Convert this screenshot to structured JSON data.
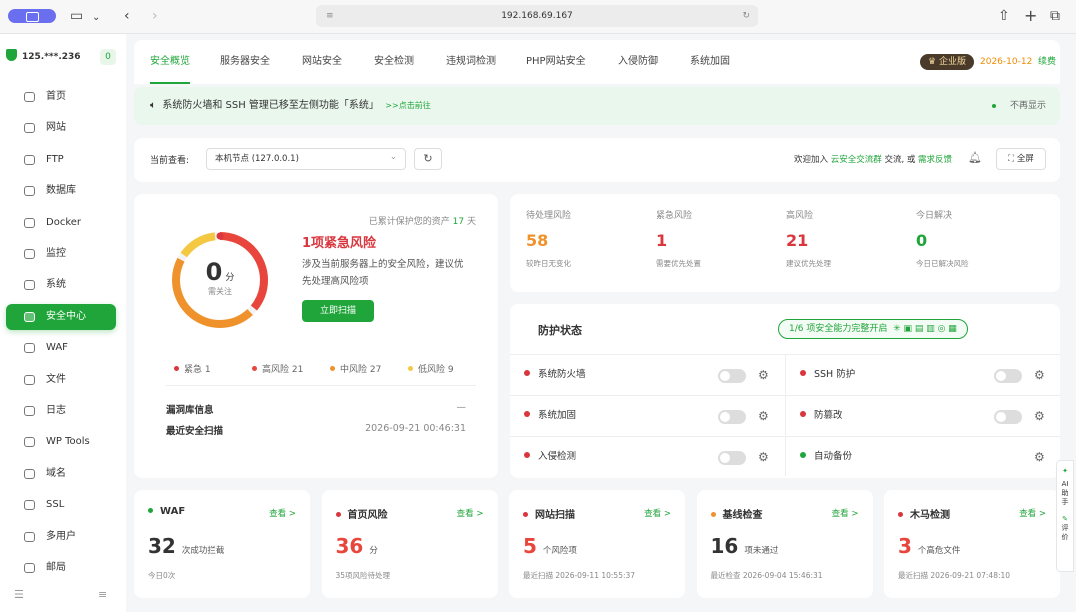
{
  "browser": {
    "address": "192.168.69.167"
  },
  "sidebar": {
    "host": "125.***.236",
    "host_count": "0",
    "items": [
      {
        "label": "首页",
        "icon": "home-icon"
      },
      {
        "label": "网站",
        "icon": "globe-icon"
      },
      {
        "label": "FTP",
        "icon": "transfer-icon"
      },
      {
        "label": "数据库",
        "icon": "database-icon"
      },
      {
        "label": "Docker",
        "icon": "docker-icon"
      },
      {
        "label": "监控",
        "icon": "monitor-icon"
      },
      {
        "label": "系统",
        "icon": "system-icon"
      },
      {
        "label": "安全中心",
        "icon": "shield-icon",
        "active": true
      },
      {
        "label": "WAF",
        "icon": "waf-icon"
      },
      {
        "label": "文件",
        "icon": "folder-icon"
      },
      {
        "label": "日志",
        "icon": "log-icon"
      },
      {
        "label": "WP Tools",
        "icon": "wordpress-icon"
      },
      {
        "label": "域名",
        "icon": "domain-icon"
      },
      {
        "label": "SSL",
        "icon": "ssl-icon"
      },
      {
        "label": "多用户",
        "icon": "users-icon"
      },
      {
        "label": "邮局",
        "icon": "mail-icon"
      }
    ]
  },
  "tabs": [
    "安全概览",
    "服务器安全",
    "网站安全",
    "安全检测",
    "违规词检测",
    "PHP网站安全",
    "入侵防御",
    "系统加固"
  ],
  "edition": {
    "badge": "企业版",
    "date": "2026-10-12",
    "renew": "续费"
  },
  "notice": {
    "text": "系统防火墙和 SSH 管理已移至左侧功能「系统」",
    "link": ">>点击前往",
    "hide": "不再显示"
  },
  "toolbar": {
    "view_label": "当前查看:",
    "node": "本机节点 (127.0.0.1)",
    "join_prefix": "欢迎加入",
    "group": "云安全交流群",
    "mid": "交流, 或",
    "feedback": "需求反馈",
    "fullscreen": "全屏"
  },
  "risk": {
    "protected_prefix": "已累计保护您的资产",
    "protected_days": "17",
    "protected_suffix": "天",
    "score": "0",
    "score_unit": "分",
    "score_note": "需关注",
    "title": "1项紧急风险",
    "desc1": "涉及当前服务器上的安全风险，建议优",
    "desc2": "先处理高风险项",
    "scan_button": "立即扫描",
    "legend": [
      {
        "label": "紧急",
        "value": "1",
        "color": "#d9363e"
      },
      {
        "label": "高风险",
        "value": "21",
        "color": "#e8453c"
      },
      {
        "label": "中风险",
        "value": "27",
        "color": "#f0922b"
      },
      {
        "label": "低风险",
        "value": "9",
        "color": "#f5c842"
      }
    ],
    "vuln_label": "漏洞库信息",
    "vuln_value": "—",
    "last_scan_label": "最近安全扫描",
    "last_scan_value": "2026-09-21 00:46:31"
  },
  "stats": [
    {
      "label": "待处理风险",
      "value": "58",
      "sub": "较昨日无变化",
      "color": "#f0922b"
    },
    {
      "label": "紧急风险",
      "value": "1",
      "sub": "需要优先处置",
      "color": "#d9363e"
    },
    {
      "label": "高风险",
      "value": "21",
      "sub": "建议优先处理",
      "color": "#d9363e"
    },
    {
      "label": "今日解决",
      "value": "0",
      "sub": "今日已解决风险",
      "color": "#20a53a"
    }
  ],
  "protection": {
    "title": "防护状态",
    "pill": "1/6 项安全能力完整开启",
    "items": [
      {
        "label": "系统防火墙",
        "enabled": false,
        "toggle": true
      },
      {
        "label": "SSH 防护",
        "enabled": false,
        "toggle": true
      },
      {
        "label": "系统加固",
        "enabled": false,
        "toggle": true
      },
      {
        "label": "防篡改",
        "enabled": false,
        "toggle": true
      },
      {
        "label": "入侵检测",
        "enabled": false,
        "toggle": true
      },
      {
        "label": "自动备份",
        "enabled": true,
        "toggle": false
      }
    ]
  },
  "summary": [
    {
      "title": "WAF",
      "link": "查看 >",
      "value": "32",
      "unit": "次成功拦截",
      "foot": "今日0次",
      "dot": "#20a53a",
      "color": "#333"
    },
    {
      "title": "首页风险",
      "link": "查看 >",
      "value": "36",
      "unit": "分",
      "foot": "35项风险待处理",
      "dot": "#d9363e",
      "color": "#e8453c"
    },
    {
      "title": "网站扫描",
      "link": "查看 >",
      "value": "5",
      "unit": "个风险项",
      "foot": "最近扫描 2026-09-11 10:55:37",
      "dot": "#d9363e",
      "color": "#e8453c"
    },
    {
      "title": "基线检查",
      "link": "查看 >",
      "value": "16",
      "unit": "项未通过",
      "foot": "最近检查 2026-09-04 15:46:31",
      "dot": "#f0922b",
      "color": "#333"
    },
    {
      "title": "木马检测",
      "link": "查看 >",
      "value": "3",
      "unit": "个高危文件",
      "foot": "最近扫描 2026-09-21 07:48:10",
      "dot": "#d9363e",
      "color": "#e8453c"
    }
  ],
  "ai_panel": {
    "label1": "AI",
    "label2": "助",
    "label3": "手",
    "label4": "评",
    "label5": "价"
  }
}
